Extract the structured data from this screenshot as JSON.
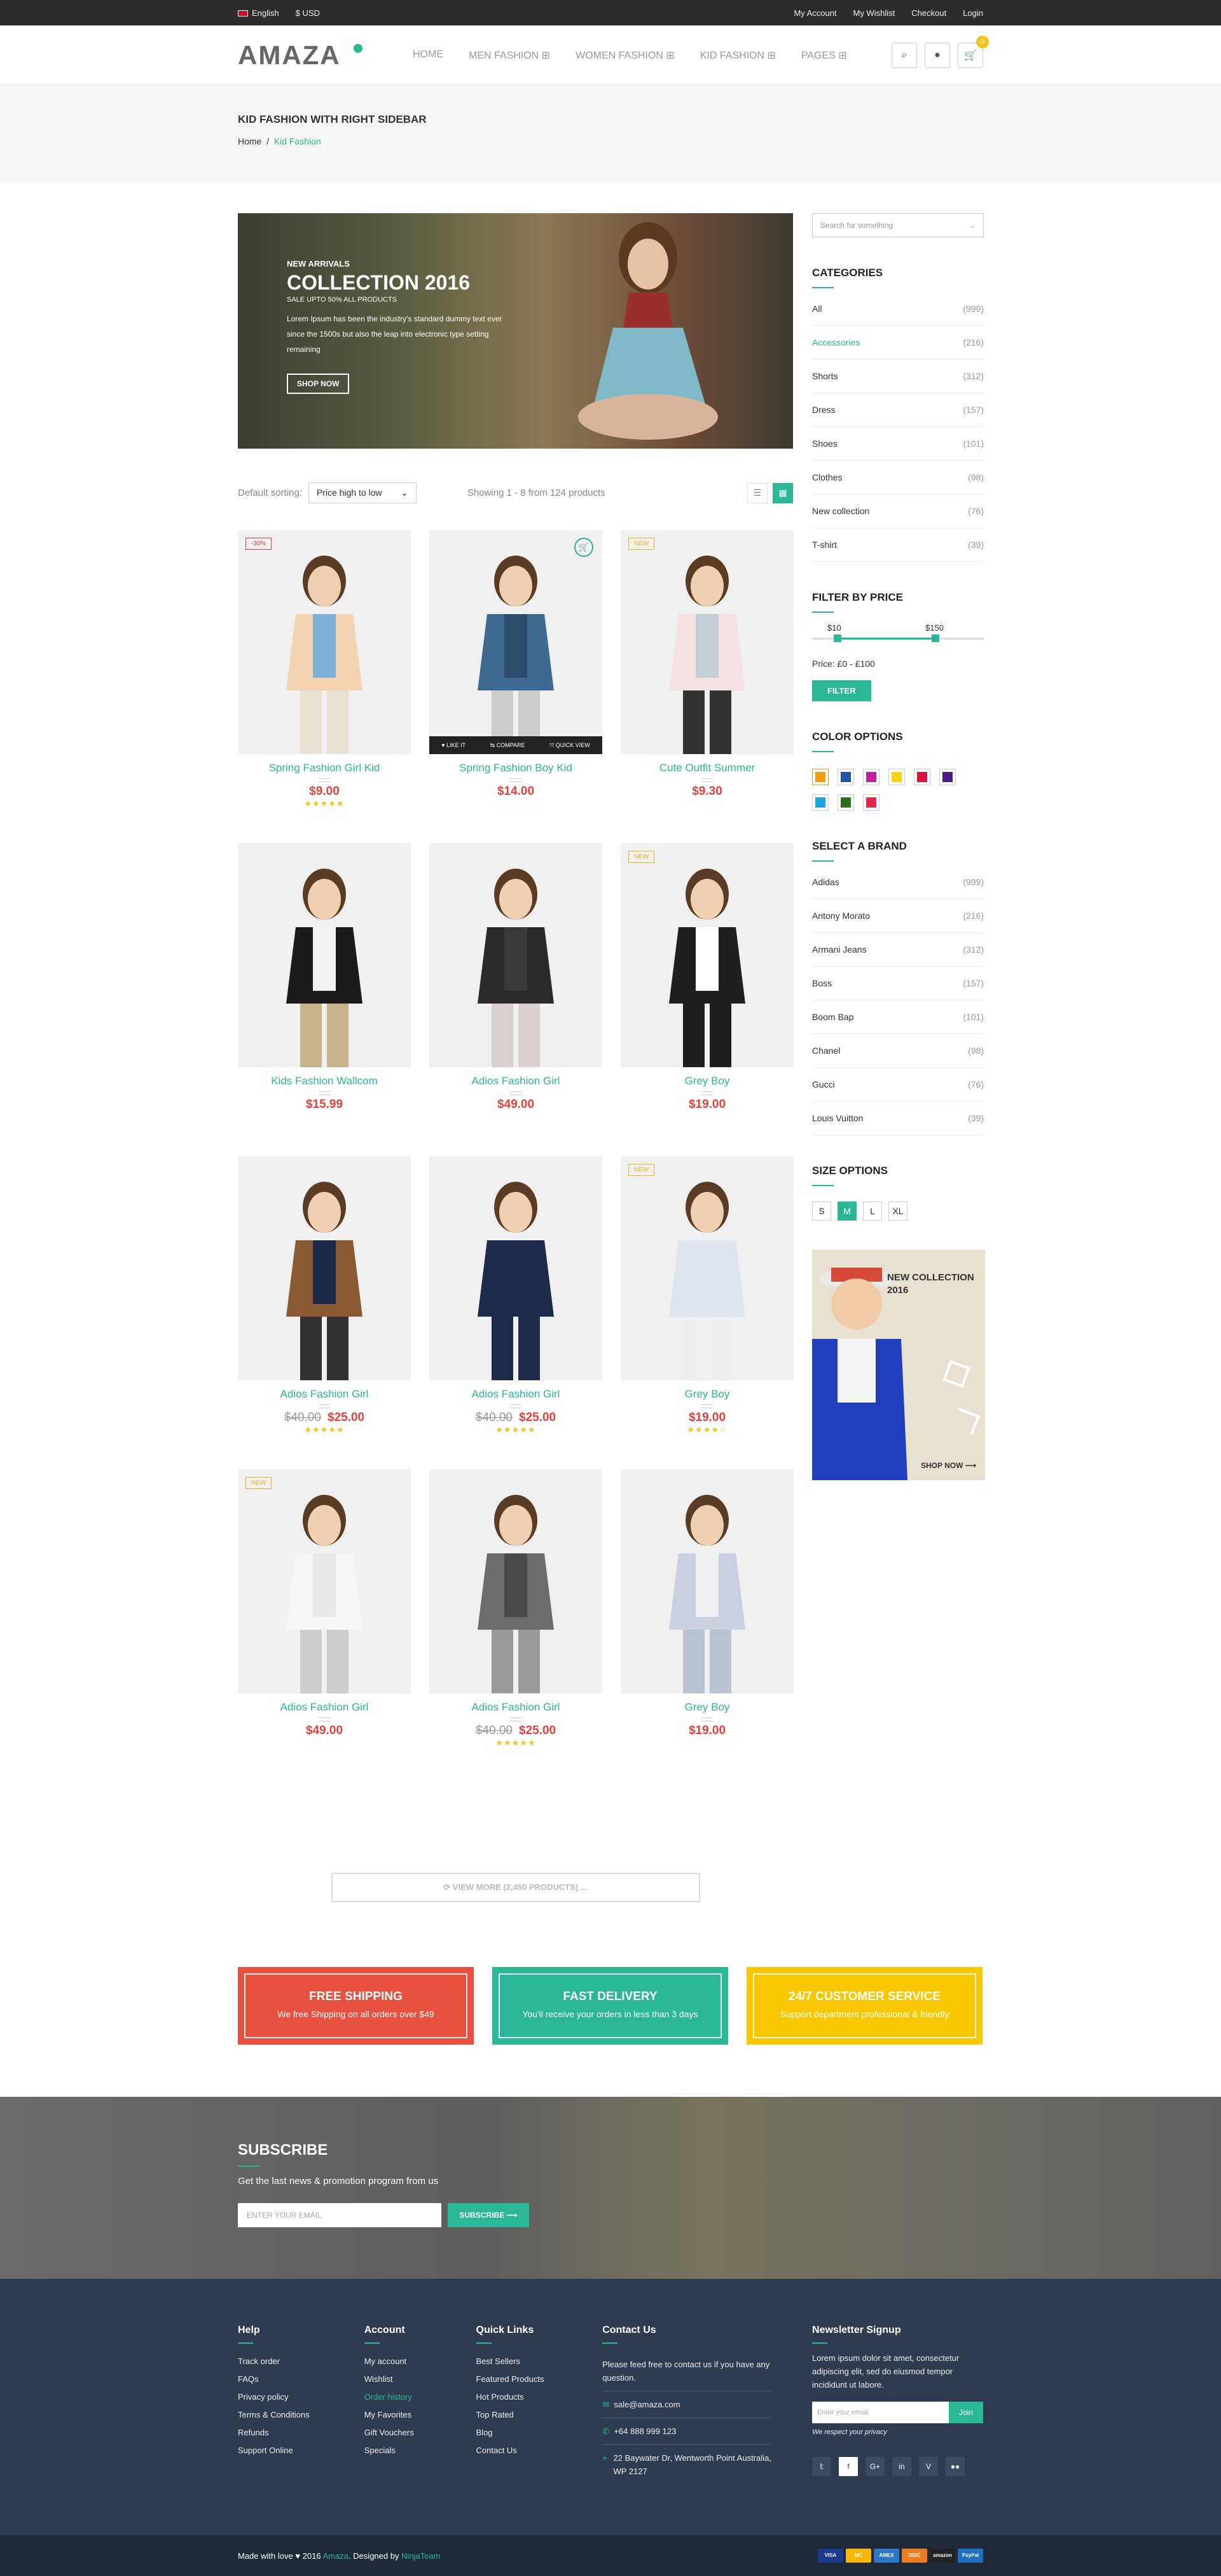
{
  "topbar": {
    "language": "English",
    "currency": "$ USD",
    "links": [
      "My Account",
      "My Wishlist",
      "Checkout",
      "Login"
    ]
  },
  "header": {
    "logo": "AMAZA",
    "nav": [
      "HOME",
      "MEN FASHION ⊞",
      "WOMEN FASHION ⊞",
      "KID FASHION ⊞",
      "PAGES ⊞"
    ],
    "cart_count": "0"
  },
  "titlebar": {
    "title": "KID FASHION WITH RIGHT SIDEBAR",
    "crumb_home": "Home",
    "crumb_sep": "/",
    "crumb_current": "Kid Fashion"
  },
  "hero": {
    "label": "NEW ARRIVALS",
    "title": "COLLECTION 2016",
    "sale": "SALE UPTO 50% ALL PRODUCTS",
    "desc": "Lorem Ipsum has been the industry's standard dummy text ever since the 1500s but also the leap into electronic type setting remaining",
    "button": "SHOP NOW"
  },
  "toolbar": {
    "sort_label": "Default sorting:",
    "sort_value": "Price high to low",
    "showing": "Showing 1 - 8 from 124 products"
  },
  "product_hover": {
    "like": "♥ LIKE IT",
    "compare": "⇆ COMPARE",
    "quick": "⤧ QUICK VIEW"
  },
  "products": [
    {
      "name": "Spring Fashion Girl Kid",
      "price": "$9.00",
      "old": "",
      "tag": "-30%",
      "stars": "★★★★★"
    },
    {
      "name": "Spring Fashion Boy Kid",
      "price": "$14.00",
      "old": "",
      "tag": "",
      "stars": ""
    },
    {
      "name": "Cute Outfit Summer",
      "price": "$9.30",
      "old": "",
      "tag": "NEW",
      "stars": ""
    },
    {
      "name": "Kids Fashion Wallcom",
      "price": "$15.99",
      "old": "",
      "tag": "",
      "stars": ""
    },
    {
      "name": "Adios Fashion Girl",
      "price": "$49.00",
      "old": "",
      "tag": "",
      "stars": ""
    },
    {
      "name": "Grey Boy",
      "price": "$19.00",
      "old": "",
      "tag": "NEW",
      "stars": ""
    },
    {
      "name": "Adios Fashion Girl",
      "price": "$25.00",
      "old": "$40.00",
      "tag": "",
      "stars": "★★★★★"
    },
    {
      "name": "Adios Fashion Girl",
      "price": "$25.00",
      "old": "$40.00",
      "tag": "",
      "stars": "★★★★★"
    },
    {
      "name": "Grey Boy",
      "price": "$19.00",
      "old": "",
      "tag": "NEW",
      "stars": "★★★★☆"
    },
    {
      "name": "Adios Fashion Girl",
      "price": "$49.00",
      "old": "",
      "tag": "NEW",
      "stars": ""
    },
    {
      "name": "Adios Fashion Girl",
      "price": "$25.00",
      "old": "$40.00",
      "tag": "",
      "stars": "★★★★★"
    },
    {
      "name": "Grey Boy",
      "price": "$19.00",
      "old": "",
      "tag": "",
      "stars": ""
    }
  ],
  "view_more": "⟳ VIEW MORE (2,450 PRODUCTS) ...",
  "sidebar": {
    "search_placeholder": "Search for something",
    "categories_title": "CATEGORIES",
    "categories": [
      [
        "All",
        "(999)"
      ],
      [
        "Accessories",
        "(216)"
      ],
      [
        "Shorts",
        "(312)"
      ],
      [
        "Dress",
        "(157)"
      ],
      [
        "Shoes",
        "(101)"
      ],
      [
        "Clothes",
        "(98)"
      ],
      [
        "New collection",
        "(76)"
      ],
      [
        "T-shirt",
        "(39)"
      ]
    ],
    "price_title": "FILTER BY PRICE",
    "price_min": "$10",
    "price_max": "$150",
    "price_text": "Price: £0 - £100",
    "filter_btn": "FILTER",
    "color_title": "COLOR OPTIONS",
    "colors": [
      "#f39c12",
      "#2253a4",
      "#c0209a",
      "#f8d30e",
      "#d9143b",
      "#4c1d8a",
      "#1aa5e0",
      "#2f6d1d",
      "#e2264d"
    ],
    "brand_title": "SELECT A BRAND",
    "brands": [
      [
        "Adidas",
        "(999)"
      ],
      [
        "Antony Morato",
        "(216)"
      ],
      [
        "Armani Jeans",
        "(312)"
      ],
      [
        "Boss",
        "(157)"
      ],
      [
        "Boom Bap",
        "(101)"
      ],
      [
        "Chanel",
        "(98)"
      ],
      [
        "Gucci",
        "(76)"
      ],
      [
        "Louis Vuitton",
        "(39)"
      ]
    ],
    "size_title": "SIZE OPTIONS",
    "sizes": [
      "S",
      "M",
      "L",
      "XL"
    ],
    "banner_title": "NEW COLLECTION 2016",
    "banner_link": "SHOP NOW ⟶"
  },
  "features": [
    {
      "title": "FREE SHIPPING",
      "sub": "We free Shipping on all orders over $49",
      "color": "#e8503f"
    },
    {
      "title": "FAST DELIVERY",
      "sub": "You'll receive your orders in less than 3 days",
      "color": "#2ab795"
    },
    {
      "title": "24/7 CUSTOMER SERVICE",
      "sub": "Support department professional & friendly",
      "color": "#f8c700"
    }
  ],
  "subscribe": {
    "title": "SUBSCRIBE",
    "text": "Get the last news & promotion program from us",
    "placeholder": "ENTER YOUR EMAIL",
    "button": "SUBSCRIBE ⟶"
  },
  "footer": {
    "help_title": "Help",
    "help": [
      "Track order",
      "FAQs",
      "Privacy policy",
      "Terms & Conditions",
      "Refunds",
      "Support Online"
    ],
    "account_title": "Account",
    "account": [
      "My account",
      "Wishlist",
      "Order history",
      "My Favorites",
      "Gift Vouchers",
      "Specials"
    ],
    "links_title": "Quick Links",
    "links": [
      "Best Sellers",
      "Featured Products",
      "Hot Products",
      "Top Rated",
      "Blog",
      "Contact Us"
    ],
    "contact_title": "Contact Us",
    "contact_text": "Please feed free to contact us if you have any question.",
    "email": "sale@amaza.com",
    "phone": "+64 888 999 123",
    "address": "22 Baywater Dr, Wentworth Point Australia, WP 2127",
    "news_title": "Newsletter Signup",
    "news_text": "Lorem ipsum dolor sit amet, consectetur adipiscing elit, sed do eiusmod tempor incididunt ut labore.",
    "news_placeholder": "Enter your email",
    "news_button": "Join",
    "news_privacy": "We respect your privacy",
    "social": [
      "𝕥",
      "f",
      "G+",
      "in",
      "V",
      "●●"
    ]
  },
  "bottom": {
    "made": "Made with love",
    "year": " 2016 ",
    "brand": "Amaza",
    "designed": ". Designed by ",
    "designer": "NinjaTeam",
    "pay": [
      "VISA",
      "MC",
      "AMEX",
      "DISC",
      "amazon",
      "PayPal"
    ]
  }
}
